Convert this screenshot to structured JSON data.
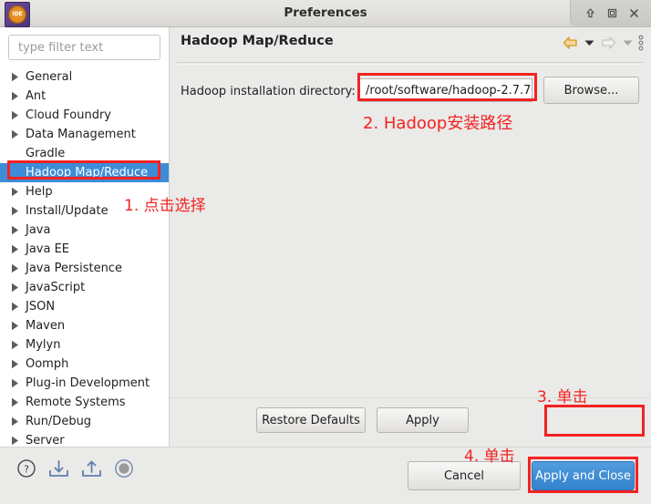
{
  "window": {
    "title": "Preferences",
    "app_icon": "eclipse-icon",
    "controls": [
      {
        "name": "shade-button",
        "icon": "up-arrow-icon"
      },
      {
        "name": "maximize-button",
        "icon": "square-icon"
      },
      {
        "name": "close-button",
        "icon": "close-x-icon"
      }
    ]
  },
  "sidebar": {
    "filter": {
      "placeholder": "type filter text",
      "value": ""
    },
    "items": [
      {
        "label": "General",
        "expandable": true,
        "selected": false
      },
      {
        "label": "Ant",
        "expandable": true,
        "selected": false
      },
      {
        "label": "Cloud Foundry",
        "expandable": true,
        "selected": false
      },
      {
        "label": "Data Management",
        "expandable": true,
        "selected": false
      },
      {
        "label": "Gradle",
        "expandable": false,
        "selected": false
      },
      {
        "label": "Hadoop Map/Reduce",
        "expandable": false,
        "selected": true
      },
      {
        "label": "Help",
        "expandable": true,
        "selected": false
      },
      {
        "label": "Install/Update",
        "expandable": true,
        "selected": false
      },
      {
        "label": "Java",
        "expandable": true,
        "selected": false
      },
      {
        "label": "Java EE",
        "expandable": true,
        "selected": false
      },
      {
        "label": "Java Persistence",
        "expandable": true,
        "selected": false
      },
      {
        "label": "JavaScript",
        "expandable": true,
        "selected": false
      },
      {
        "label": "JSON",
        "expandable": true,
        "selected": false
      },
      {
        "label": "Maven",
        "expandable": true,
        "selected": false
      },
      {
        "label": "Mylyn",
        "expandable": true,
        "selected": false
      },
      {
        "label": "Oomph",
        "expandable": true,
        "selected": false
      },
      {
        "label": "Plug-in Development",
        "expandable": true,
        "selected": false
      },
      {
        "label": "Remote Systems",
        "expandable": true,
        "selected": false
      },
      {
        "label": "Run/Debug",
        "expandable": true,
        "selected": false
      },
      {
        "label": "Server",
        "expandable": true,
        "selected": false
      }
    ]
  },
  "page": {
    "title": "Hadoop Map/Reduce",
    "toolbar": [
      {
        "name": "back-icon",
        "enabled": true
      },
      {
        "name": "back-dropdown-icon",
        "enabled": true
      },
      {
        "name": "forward-icon",
        "enabled": false
      },
      {
        "name": "forward-dropdown-icon",
        "enabled": false
      },
      {
        "name": "view-menu-icon",
        "enabled": true
      }
    ],
    "field": {
      "label": "Hadoop installation directory:",
      "value": "/root/software/hadoop-2.7.7",
      "browse_label": "Browse..."
    },
    "restore_defaults_label": "Restore Defaults",
    "apply_label": "Apply"
  },
  "footer": {
    "icons": [
      {
        "name": "help-icon"
      },
      {
        "name": "import-icon"
      },
      {
        "name": "export-icon"
      },
      {
        "name": "circle-icon"
      }
    ],
    "cancel_label": "Cancel",
    "apply_and_close_label": "Apply and Close"
  },
  "annotations": [
    {
      "id": "a1",
      "text": "1. 点击选择"
    },
    {
      "id": "a2",
      "text": "2. Hadoop安装路径"
    },
    {
      "id": "a3",
      "text": "3. 单击"
    },
    {
      "id": "a4",
      "text": "4. 单击"
    }
  ],
  "colors": {
    "annotation_red": "#f32222",
    "selection_blue": "#3d8cd8",
    "primary_button_blue": "#3f8dd4",
    "back_arrow_gold": "#e8a93a"
  }
}
